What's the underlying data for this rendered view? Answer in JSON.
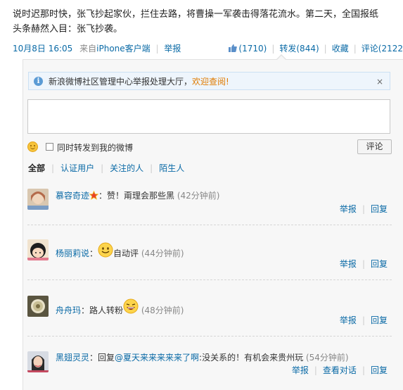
{
  "post": {
    "line1": "说时迟那时快，张飞抄起家伙，拦住去路，将曹操一军袭击得落花流水。第二天，全国报纸",
    "line2": "头条赫然入目：张飞抄袭。",
    "time": "10月8日 16:05",
    "source_prefix": "来自",
    "source": "iPhone客户端",
    "report": "举报"
  },
  "actions": {
    "like_count": "(1710)",
    "forward": "转发(844)",
    "favorite": "收藏",
    "comment": "评论(2122"
  },
  "notice": {
    "text": "新浪微博社区管理中心举报处理大厅，",
    "link": "欢迎查阅!",
    "close": "×"
  },
  "composer": {
    "forward_label": "同时转发到我的微博",
    "submit": "评论"
  },
  "filters": {
    "all": "全部",
    "verified": "认证用户",
    "following": "关注的人",
    "strangers": "陌生人"
  },
  "comments": [
    {
      "user": "慕容奇迹",
      "text": "：赞！甭理会那些黑",
      "time": "(42分钟前)",
      "report": "举报",
      "reply": "回复"
    },
    {
      "user": "杨丽莉说",
      "text": "：",
      "text2": "自动评",
      "time": "(44分钟前)",
      "report": "举报",
      "reply": "回复"
    },
    {
      "user": "舟舟玛",
      "text": "：路人转粉",
      "time": "(48分钟前)",
      "report": "举报",
      "reply": "回复"
    },
    {
      "user": "黑翅灵灵",
      "text": "：回复",
      "mention": "@夏天来来来来来了啊",
      "text2": ":没关系的！有机会来贵州玩",
      "time": "(54分钟前)",
      "report": "举报",
      "view_thread": "查看对话",
      "reply": "回复"
    }
  ]
}
